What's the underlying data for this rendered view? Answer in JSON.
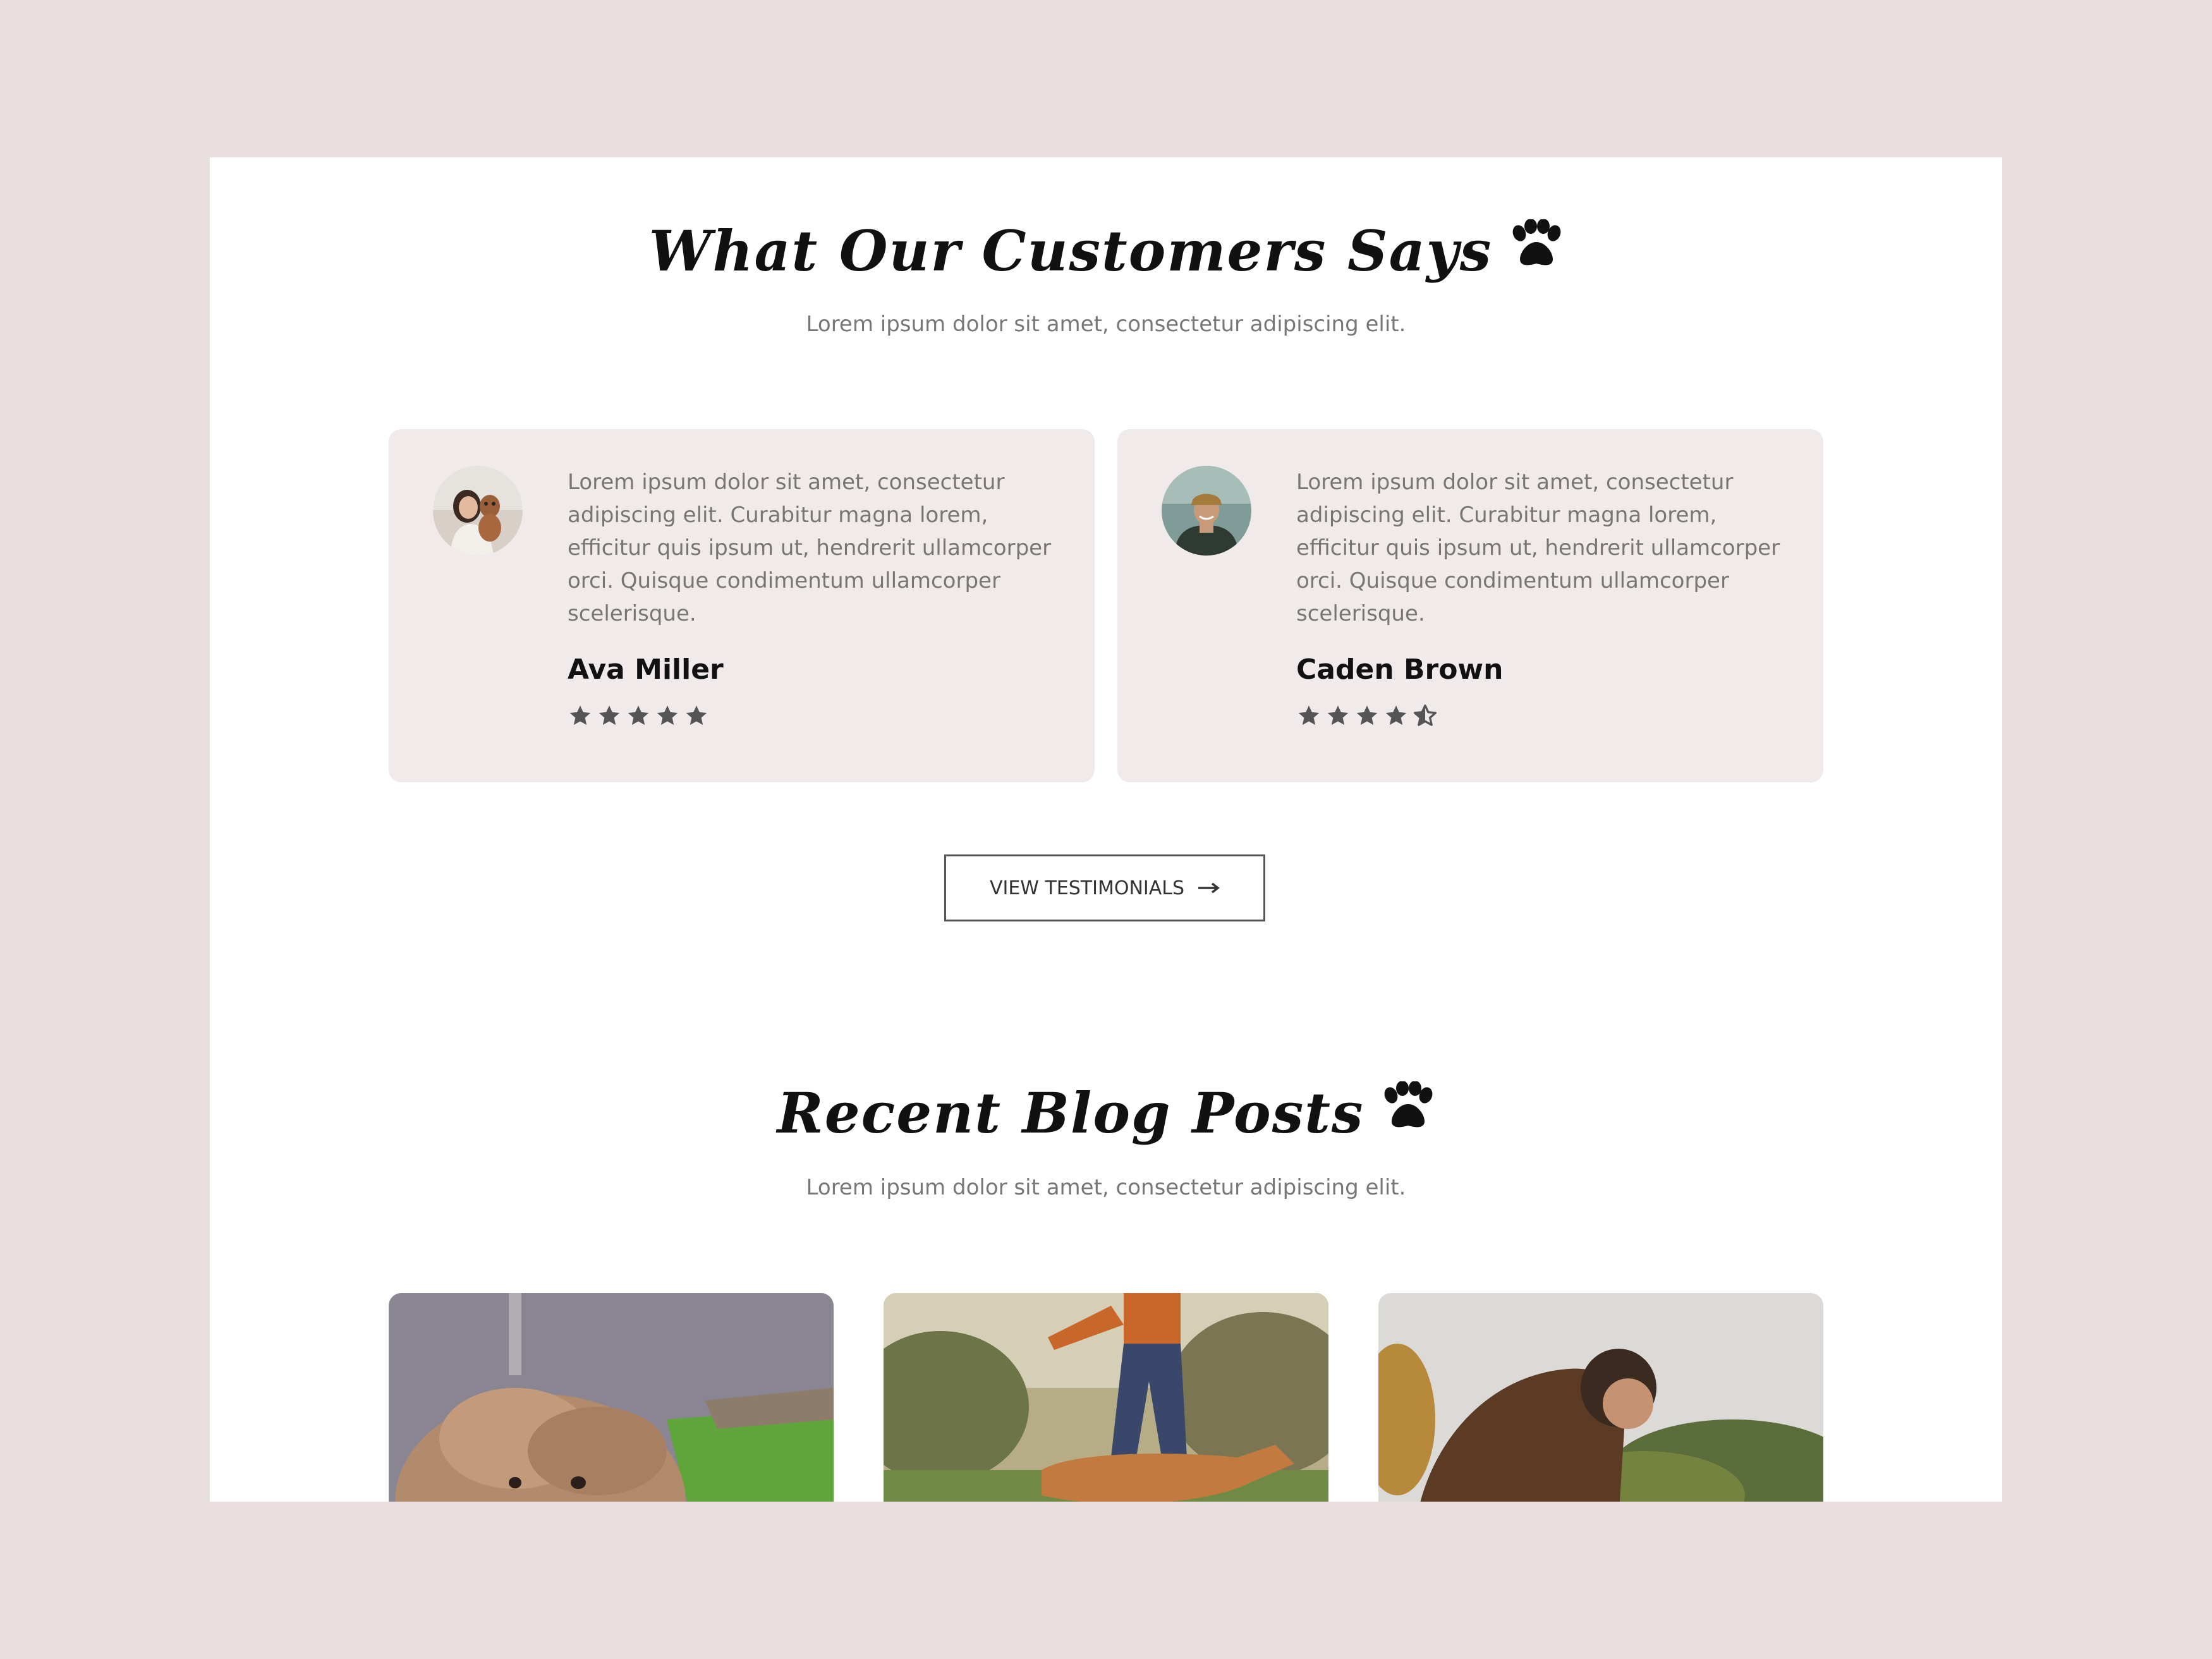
{
  "testimonials_section": {
    "title": "What Our Customers Says",
    "subtitle": "Lorem ipsum dolor sit amet, consectetur adipiscing elit.",
    "icon": "paw-icon"
  },
  "testimonials": [
    {
      "quote": "Lorem ipsum dolor sit amet, consectetur adipiscing elit. Curabitur magna lorem, efficitur quis ipsum ut, hendrerit ullamcorper orci. Quisque condimentum ullamcorper scelerisque.",
      "name": "Ava Miller",
      "rating": 5
    },
    {
      "quote": "Lorem ipsum dolor sit amet, consectetur adipiscing elit. Curabitur magna lorem, efficitur quis ipsum ut, hendrerit ullamcorper orci. Quisque condimentum ullamcorper scelerisque.",
      "name": "Caden Brown",
      "rating": 4.5
    }
  ],
  "view_button": {
    "label": "VIEW TESTIMONIALS",
    "icon": "arrow-right-icon"
  },
  "blog_section": {
    "title": "Recent Blog Posts",
    "subtitle": "Lorem ipsum dolor sit amet, consectetur adipiscing elit.",
    "icon": "paw-icon"
  },
  "colors": {
    "page_background": "#e8dfde",
    "card_background": "#f0eaea",
    "star": "#555555",
    "heading": "#111111",
    "body_text": "#7a7575"
  }
}
